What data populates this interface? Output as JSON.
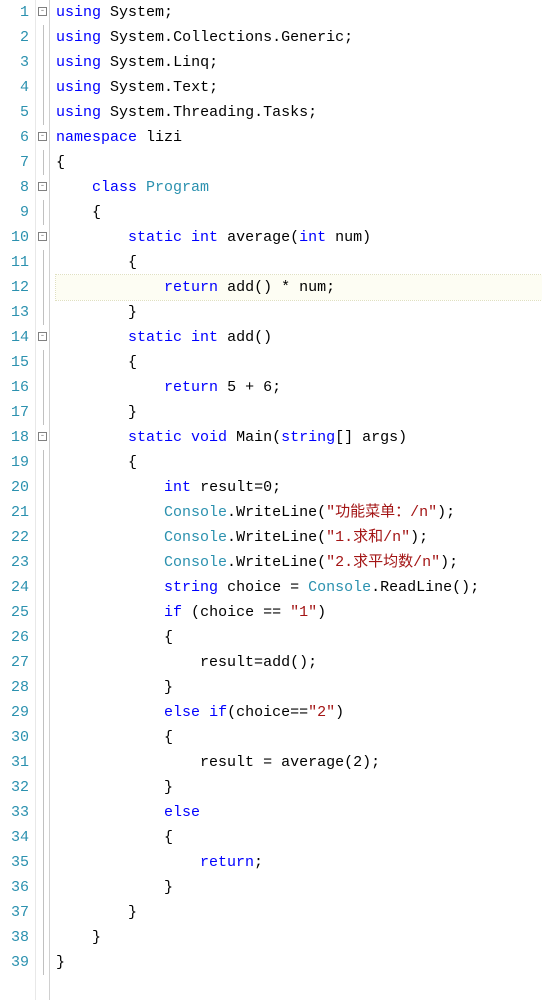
{
  "highlight_line": 12,
  "lines": [
    {
      "n": 1,
      "fold": "box",
      "tokens": [
        [
          "kw",
          "using"
        ],
        [
          "txt",
          " "
        ],
        [
          "txt",
          "System"
        ],
        [
          "txt",
          ";"
        ]
      ]
    },
    {
      "n": 2,
      "fold": "line",
      "tokens": [
        [
          "kw",
          "using"
        ],
        [
          "txt",
          " "
        ],
        [
          "txt",
          "System"
        ],
        [
          "txt",
          "."
        ],
        [
          "txt",
          "Collections"
        ],
        [
          "txt",
          "."
        ],
        [
          "txt",
          "Generic"
        ],
        [
          "txt",
          ";"
        ]
      ]
    },
    {
      "n": 3,
      "fold": "line",
      "tokens": [
        [
          "kw",
          "using"
        ],
        [
          "txt",
          " "
        ],
        [
          "txt",
          "System"
        ],
        [
          "txt",
          "."
        ],
        [
          "txt",
          "Linq"
        ],
        [
          "txt",
          ";"
        ]
      ]
    },
    {
      "n": 4,
      "fold": "line",
      "tokens": [
        [
          "kw",
          "using"
        ],
        [
          "txt",
          " "
        ],
        [
          "txt",
          "System"
        ],
        [
          "txt",
          "."
        ],
        [
          "txt",
          "Text"
        ],
        [
          "txt",
          ";"
        ]
      ]
    },
    {
      "n": 5,
      "fold": "line",
      "tokens": [
        [
          "kw",
          "using"
        ],
        [
          "txt",
          " "
        ],
        [
          "txt",
          "System"
        ],
        [
          "txt",
          "."
        ],
        [
          "txt",
          "Threading"
        ],
        [
          "txt",
          "."
        ],
        [
          "txt",
          "Tasks"
        ],
        [
          "txt",
          ";"
        ]
      ]
    },
    {
      "n": 6,
      "fold": "box",
      "tokens": [
        [
          "kw",
          "namespace"
        ],
        [
          "txt",
          " "
        ],
        [
          "txt",
          "lizi"
        ]
      ]
    },
    {
      "n": 7,
      "fold": "line",
      "tokens": [
        [
          "txt",
          "{"
        ]
      ]
    },
    {
      "n": 8,
      "fold": "box",
      "tokens": [
        [
          "txt",
          "    "
        ],
        [
          "kw",
          "class"
        ],
        [
          "txt",
          " "
        ],
        [
          "type",
          "Program"
        ]
      ]
    },
    {
      "n": 9,
      "fold": "line",
      "tokens": [
        [
          "txt",
          "    {"
        ]
      ]
    },
    {
      "n": 10,
      "fold": "box",
      "tokens": [
        [
          "txt",
          "        "
        ],
        [
          "kw",
          "static"
        ],
        [
          "txt",
          " "
        ],
        [
          "kw",
          "int"
        ],
        [
          "txt",
          " "
        ],
        [
          "txt",
          "average"
        ],
        [
          "txt",
          "("
        ],
        [
          "kw",
          "int"
        ],
        [
          "txt",
          " "
        ],
        [
          "txt",
          "num"
        ],
        [
          "txt",
          ")"
        ]
      ]
    },
    {
      "n": 11,
      "fold": "line",
      "tokens": [
        [
          "txt",
          "        {"
        ]
      ]
    },
    {
      "n": 12,
      "fold": "line",
      "tokens": [
        [
          "txt",
          "            "
        ],
        [
          "kw",
          "return"
        ],
        [
          "txt",
          " "
        ],
        [
          "txt",
          "add"
        ],
        [
          "txt",
          "()"
        ],
        [
          "txt",
          " "
        ],
        [
          "op",
          "*"
        ],
        [
          "txt",
          " "
        ],
        [
          "txt",
          "num"
        ],
        [
          "txt",
          ";"
        ]
      ]
    },
    {
      "n": 13,
      "fold": "line",
      "tokens": [
        [
          "txt",
          "        }"
        ]
      ]
    },
    {
      "n": 14,
      "fold": "box",
      "tokens": [
        [
          "txt",
          "        "
        ],
        [
          "kw",
          "static"
        ],
        [
          "txt",
          " "
        ],
        [
          "kw",
          "int"
        ],
        [
          "txt",
          " "
        ],
        [
          "txt",
          "add"
        ],
        [
          "txt",
          "()"
        ]
      ]
    },
    {
      "n": 15,
      "fold": "line",
      "tokens": [
        [
          "txt",
          "        {"
        ]
      ]
    },
    {
      "n": 16,
      "fold": "line",
      "tokens": [
        [
          "txt",
          "            "
        ],
        [
          "kw",
          "return"
        ],
        [
          "txt",
          " "
        ],
        [
          "num",
          "5"
        ],
        [
          "txt",
          " "
        ],
        [
          "op",
          "+"
        ],
        [
          "txt",
          " "
        ],
        [
          "num",
          "6"
        ],
        [
          "txt",
          ";"
        ]
      ]
    },
    {
      "n": 17,
      "fold": "line",
      "tokens": [
        [
          "txt",
          "        }"
        ]
      ]
    },
    {
      "n": 18,
      "fold": "box",
      "tokens": [
        [
          "txt",
          "        "
        ],
        [
          "kw",
          "static"
        ],
        [
          "txt",
          " "
        ],
        [
          "kw",
          "void"
        ],
        [
          "txt",
          " "
        ],
        [
          "txt",
          "Main"
        ],
        [
          "txt",
          "("
        ],
        [
          "kw",
          "string"
        ],
        [
          "txt",
          "[] "
        ],
        [
          "txt",
          "args"
        ],
        [
          "txt",
          ")"
        ]
      ]
    },
    {
      "n": 19,
      "fold": "line",
      "tokens": [
        [
          "txt",
          "        {"
        ]
      ]
    },
    {
      "n": 20,
      "fold": "line",
      "tokens": [
        [
          "txt",
          "            "
        ],
        [
          "kw",
          "int"
        ],
        [
          "txt",
          " "
        ],
        [
          "txt",
          "result"
        ],
        [
          "op",
          "="
        ],
        [
          "num",
          "0"
        ],
        [
          "txt",
          ";"
        ]
      ]
    },
    {
      "n": 21,
      "fold": "line",
      "tokens": [
        [
          "txt",
          "            "
        ],
        [
          "type",
          "Console"
        ],
        [
          "txt",
          "."
        ],
        [
          "txt",
          "WriteLine"
        ],
        [
          "txt",
          "("
        ],
        [
          "str",
          "\"功能菜单：/n\""
        ],
        [
          "txt",
          ")"
        ],
        [
          "txt",
          ";"
        ]
      ]
    },
    {
      "n": 22,
      "fold": "line",
      "tokens": [
        [
          "txt",
          "            "
        ],
        [
          "type",
          "Console"
        ],
        [
          "txt",
          "."
        ],
        [
          "txt",
          "WriteLine"
        ],
        [
          "txt",
          "("
        ],
        [
          "str",
          "\"1.求和/n\""
        ],
        [
          "txt",
          ")"
        ],
        [
          "txt",
          ";"
        ]
      ]
    },
    {
      "n": 23,
      "fold": "line",
      "tokens": [
        [
          "txt",
          "            "
        ],
        [
          "type",
          "Console"
        ],
        [
          "txt",
          "."
        ],
        [
          "txt",
          "WriteLine"
        ],
        [
          "txt",
          "("
        ],
        [
          "str",
          "\"2.求平均数/n\""
        ],
        [
          "txt",
          ")"
        ],
        [
          "txt",
          ";"
        ]
      ]
    },
    {
      "n": 24,
      "fold": "line",
      "tokens": [
        [
          "txt",
          "            "
        ],
        [
          "kw",
          "string"
        ],
        [
          "txt",
          " "
        ],
        [
          "txt",
          "choice"
        ],
        [
          "txt",
          " "
        ],
        [
          "op",
          "="
        ],
        [
          "txt",
          " "
        ],
        [
          "type",
          "Console"
        ],
        [
          "txt",
          "."
        ],
        [
          "txt",
          "ReadLine"
        ],
        [
          "txt",
          "()"
        ],
        [
          "txt",
          ";"
        ]
      ]
    },
    {
      "n": 25,
      "fold": "line",
      "tokens": [
        [
          "txt",
          "            "
        ],
        [
          "kw",
          "if"
        ],
        [
          "txt",
          " ("
        ],
        [
          "txt",
          "choice"
        ],
        [
          "txt",
          " "
        ],
        [
          "op",
          "=="
        ],
        [
          "txt",
          " "
        ],
        [
          "str",
          "\"1\""
        ],
        [
          "txt",
          ")"
        ]
      ]
    },
    {
      "n": 26,
      "fold": "line",
      "tokens": [
        [
          "txt",
          "            {"
        ]
      ]
    },
    {
      "n": 27,
      "fold": "line",
      "tokens": [
        [
          "txt",
          "                "
        ],
        [
          "txt",
          "result"
        ],
        [
          "op",
          "="
        ],
        [
          "txt",
          "add"
        ],
        [
          "txt",
          "()"
        ],
        [
          "txt",
          ";"
        ]
      ]
    },
    {
      "n": 28,
      "fold": "line",
      "tokens": [
        [
          "txt",
          "            }"
        ]
      ]
    },
    {
      "n": 29,
      "fold": "line",
      "tokens": [
        [
          "txt",
          "            "
        ],
        [
          "kw",
          "else"
        ],
        [
          "txt",
          " "
        ],
        [
          "kw",
          "if"
        ],
        [
          "txt",
          "("
        ],
        [
          "txt",
          "choice"
        ],
        [
          "op",
          "=="
        ],
        [
          "str",
          "\"2\""
        ],
        [
          "txt",
          ")"
        ]
      ]
    },
    {
      "n": 30,
      "fold": "line",
      "tokens": [
        [
          "txt",
          "            {"
        ]
      ]
    },
    {
      "n": 31,
      "fold": "line",
      "tokens": [
        [
          "txt",
          "                "
        ],
        [
          "txt",
          "result"
        ],
        [
          "txt",
          " "
        ],
        [
          "op",
          "="
        ],
        [
          "txt",
          " "
        ],
        [
          "txt",
          "average"
        ],
        [
          "txt",
          "("
        ],
        [
          "num",
          "2"
        ],
        [
          "txt",
          ")"
        ],
        [
          "txt",
          ";"
        ]
      ]
    },
    {
      "n": 32,
      "fold": "line",
      "tokens": [
        [
          "txt",
          "            }"
        ]
      ]
    },
    {
      "n": 33,
      "fold": "line",
      "tokens": [
        [
          "txt",
          "            "
        ],
        [
          "kw",
          "else"
        ]
      ]
    },
    {
      "n": 34,
      "fold": "line",
      "tokens": [
        [
          "txt",
          "            {"
        ]
      ]
    },
    {
      "n": 35,
      "fold": "line",
      "tokens": [
        [
          "txt",
          "                "
        ],
        [
          "kw",
          "return"
        ],
        [
          "txt",
          ";"
        ]
      ]
    },
    {
      "n": 36,
      "fold": "line",
      "tokens": [
        [
          "txt",
          "            }"
        ]
      ]
    },
    {
      "n": 37,
      "fold": "line",
      "tokens": [
        [
          "txt",
          "        }"
        ]
      ]
    },
    {
      "n": 38,
      "fold": "line",
      "tokens": [
        [
          "txt",
          "    }"
        ]
      ]
    },
    {
      "n": 39,
      "fold": "line",
      "tokens": [
        [
          "txt",
          "}"
        ]
      ]
    }
  ]
}
